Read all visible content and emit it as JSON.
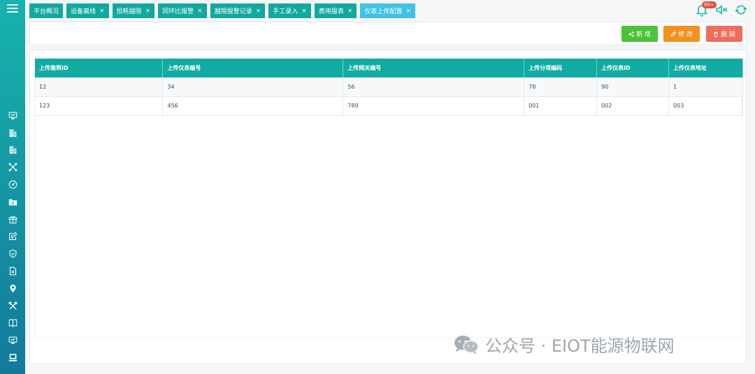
{
  "tabs": [
    {
      "label": "平台概况",
      "closable": false,
      "active": false
    },
    {
      "label": "设备离线",
      "closable": true,
      "active": false
    },
    {
      "label": "损耗越限",
      "closable": true,
      "active": false
    },
    {
      "label": "同环比报警",
      "closable": true,
      "active": false
    },
    {
      "label": "越限报警记录",
      "closable": true,
      "active": false
    },
    {
      "label": "手工录入",
      "closable": true,
      "active": false
    },
    {
      "label": "费用报表",
      "closable": true,
      "active": false
    },
    {
      "label": "仪表上传配置",
      "closable": true,
      "active": true
    }
  ],
  "close_glyph": "×",
  "notifications": {
    "badge": "99+"
  },
  "toolbar": {
    "add_label": "新 增",
    "edit_label": "修 改",
    "delete_label": "删 除"
  },
  "table": {
    "columns": [
      "上传建筑ID",
      "上传仪表编号",
      "上传网关编号",
      "上传分项编码",
      "上传仪表ID",
      "上传仪表地址"
    ],
    "rows": [
      [
        "12",
        "34",
        "56",
        "78",
        "90",
        "1"
      ],
      [
        "123",
        "456",
        "789",
        "001",
        "002",
        "003"
      ]
    ]
  },
  "sidebar_icons": [
    "monitor-icon",
    "building-icon",
    "building-icon",
    "network-icon",
    "gauge-icon",
    "folder-icon",
    "gift-icon",
    "edit-icon",
    "shield-icon",
    "document-icon",
    "location-icon",
    "tools-icon",
    "book-icon",
    "monitor-icon",
    "terminal-icon"
  ],
  "watermark": {
    "text": "公众号 · EIOT能源物联网"
  },
  "colors": {
    "primary": "#12aba3",
    "active_tab": "#40c2e5",
    "add": "#4cc238",
    "edit": "#f2911f",
    "delete": "#ef6d5d"
  }
}
